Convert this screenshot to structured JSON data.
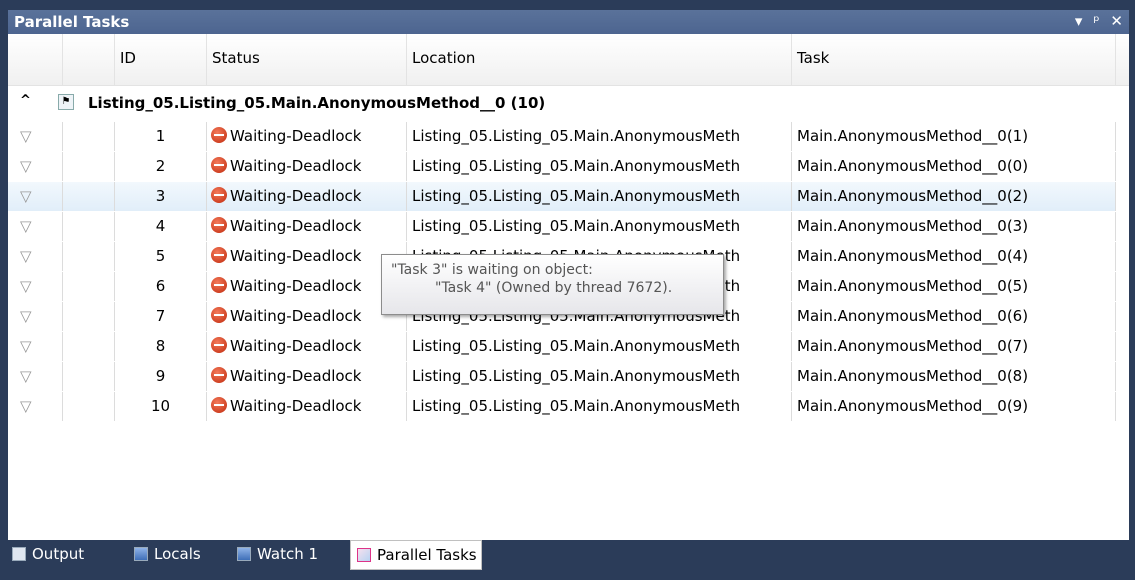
{
  "window": {
    "title": "Parallel Tasks",
    "controls": [
      "▾",
      "ᵖ",
      "✕"
    ]
  },
  "columns": [
    "ID",
    "Status",
    "Location",
    "Task"
  ],
  "group": {
    "label": "Listing_05.Listing_05.Main.AnonymousMethod__0 (10)"
  },
  "rows": [
    {
      "id": "1",
      "status": "Waiting-Deadlock",
      "location": "Listing_05.Listing_05.Main.AnonymousMeth",
      "task": "Main.AnonymousMethod__0(1)"
    },
    {
      "id": "2",
      "status": "Waiting-Deadlock",
      "location": "Listing_05.Listing_05.Main.AnonymousMeth",
      "task": "Main.AnonymousMethod__0(0)"
    },
    {
      "id": "3",
      "status": "Waiting-Deadlock",
      "location": "Listing_05.Listing_05.Main.AnonymousMeth",
      "task": "Main.AnonymousMethod__0(2)"
    },
    {
      "id": "4",
      "status": "Waiting-Deadlock",
      "location": "Listing_05.Listing_05.Main.AnonymousMeth",
      "task": "Main.AnonymousMethod__0(3)"
    },
    {
      "id": "5",
      "status": "Waiting-Deadlock",
      "location": "Listing_05.Listing_05.Main.AnonymousMeth",
      "task": "Main.AnonymousMethod__0(4)"
    },
    {
      "id": "6",
      "status": "Waiting-Deadlock",
      "location": "Listing_05.Listing_05.Main.AnonymousMeth",
      "task": "Main.AnonymousMethod__0(5)"
    },
    {
      "id": "7",
      "status": "Waiting-Deadlock",
      "location": "Listing_05.Listing_05.Main.AnonymousMeth",
      "task": "Main.AnonymousMethod__0(6)"
    },
    {
      "id": "8",
      "status": "Waiting-Deadlock",
      "location": "Listing_05.Listing_05.Main.AnonymousMeth",
      "task": "Main.AnonymousMethod__0(7)"
    },
    {
      "id": "9",
      "status": "Waiting-Deadlock",
      "location": "Listing_05.Listing_05.Main.AnonymousMeth",
      "task": "Main.AnonymousMethod__0(8)"
    },
    {
      "id": "10",
      "status": "Waiting-Deadlock",
      "location": "Listing_05.Listing_05.Main.AnonymousMeth",
      "task": "Main.AnonymousMethod__0(9)"
    }
  ],
  "tooltip": {
    "line1": "\"Task 3\" is waiting on object:",
    "line2": "\"Task 4\" (Owned by thread 7672)."
  },
  "tabs": [
    {
      "label": "Output",
      "icon": "output-icon"
    },
    {
      "label": "Locals",
      "icon": "locals-icon"
    },
    {
      "label": "Watch 1",
      "icon": "watch-icon"
    },
    {
      "label": "Parallel Tasks",
      "icon": "parallel-tasks-icon",
      "active": true
    }
  ],
  "colors": {
    "background": "#2b3c59",
    "titlebar": "#4d6590",
    "deadlock": "#d93a1a"
  }
}
